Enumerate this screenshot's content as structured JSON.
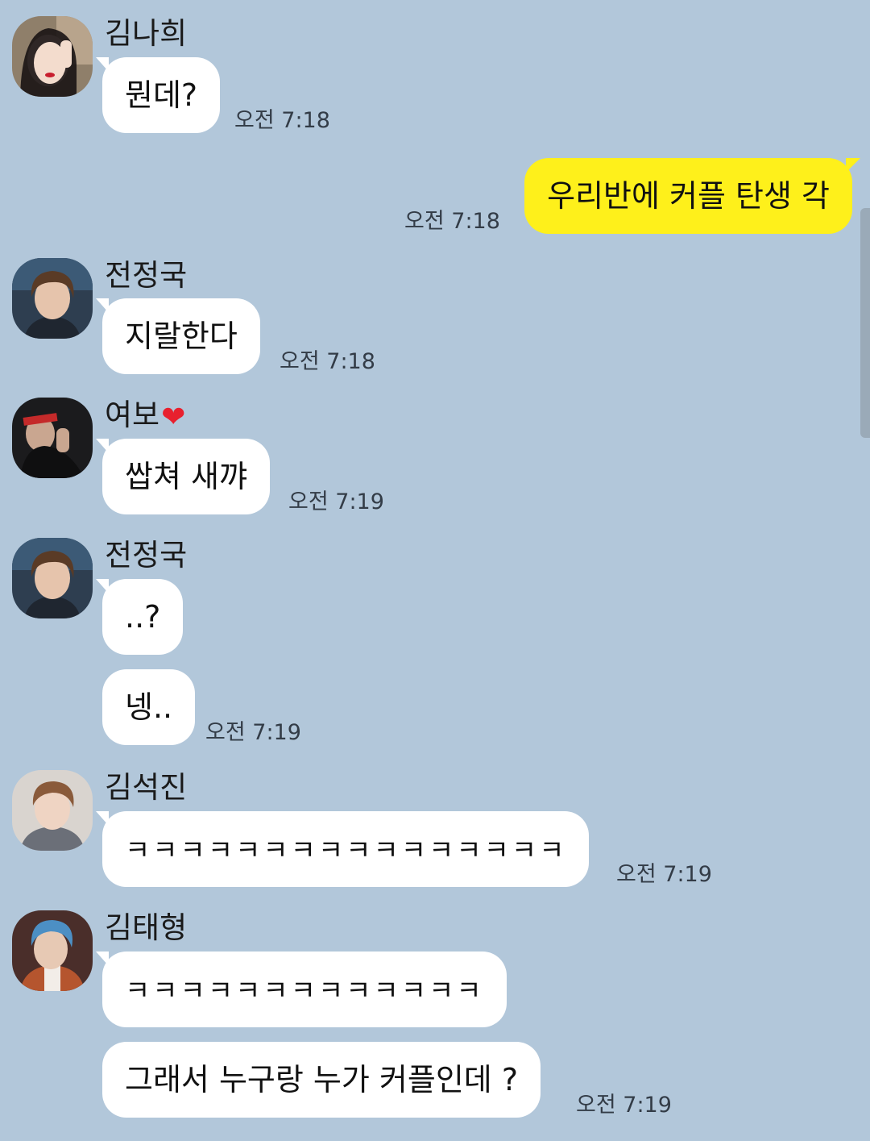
{
  "messages": [
    {
      "sender": "김나희",
      "text": "뭔데?",
      "time": "오전 7:18"
    },
    {
      "sender": "me",
      "text": "우리반에 커플 탄생 각",
      "time": "오전 7:18"
    },
    {
      "sender": "전정국",
      "text": "지랄한다",
      "time": "오전 7:18"
    },
    {
      "sender": "여보",
      "sender_emoji": "❤",
      "text": "쌉쳐 새꺄",
      "time": "오전 7:19"
    },
    {
      "sender": "전정국",
      "text": "..?",
      "time": ""
    },
    {
      "sender": "전정국",
      "text": "넹..",
      "time": "오전 7:19"
    },
    {
      "sender": "김석진",
      "text": "ㅋㅋㅋㅋㅋㅋㅋㅋㅋㅋㅋㅋㅋㅋㅋㅋ",
      "time": "오전 7:19"
    },
    {
      "sender": "김태형",
      "text": "ㅋㅋㅋㅋㅋㅋㅋㅋㅋㅋㅋㅋㅋ",
      "time": ""
    },
    {
      "sender": "김태형",
      "text": "그래서 누구랑 누가 커플인데 ?",
      "time": "오전 7:19"
    }
  ],
  "theme": {
    "background": "#b2c7da",
    "incoming_bubble": "#ffffff",
    "outgoing_bubble": "#fef01b"
  }
}
